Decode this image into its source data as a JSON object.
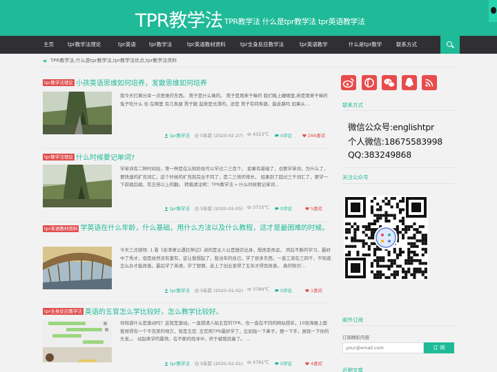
{
  "header": {
    "title": "TPR教学法",
    "subtitle": "TPR教学法 什么是tpr教学法 tpr英语教学法"
  },
  "nav": {
    "items": [
      "主页",
      "tpr教学法理论",
      "tpr英语",
      "tpr教学法",
      "tpr英语教材资料",
      "tpr全身反应教学法",
      "tpr英语教学",
      "什么是tpr教学",
      "联系方式"
    ],
    "search_icon": "search-icon"
  },
  "notice": {
    "icon": "speaker-icon",
    "text": "TPR教学法,什么是tpr教学法,tpr教学法优点,tpr教学法资料"
  },
  "articles": [
    {
      "tag": "tpr教学法理论",
      "title": "小孩英语思维如何培养，发散思维如何培养",
      "excerpt": "我今天打算分享一点思维的东西。  凳子是什么做的。  凳子是用来干嘛的  我们晚上睡哪里,床是用来干嘛的  兔子吃什么 住 在哪里   有几条腿 凳子腿 起来是光滑的。还是  凳子有四条腿，能走路吗  如果从...",
      "author": "tpr教学法",
      "time": "5年前 (2020-02-27)",
      "views": "4323℃",
      "comments": "0评论",
      "likes": "286喜欢"
    },
    {
      "tag": "tpr教学法理论",
      "title": "什么时候要记单词?",
      "excerpt": "学单词有二种时间段，第一种是在认知阶段可以学过二三百个，  如果有基础了，也要学单词，为什么了，要快速的扩充词汇，这个时候的扩充就完全不同了，是二三倍的增长，  如果到了超过三千词汇了，要学一下前缀后缀，有五倍以上的翻。  转载请注明：TPR教学法 » 什么时候要记单词...",
      "author": "tpr教学法",
      "time": "5年前 (2020-02-05)",
      "views": "3715℃",
      "comments": "0评论",
      "likes": "5喜欢"
    },
    {
      "tag": "tpr英语教材资料",
      "title": "学英语在什么年龄，什么基础，用什么方法以及什么教程，这才是最困难的时候。",
      "excerpt": "今天三点感悟: 1.看《俞净意公遇灶神记》讲的是主人公是傲农出身，想改变命运，  然后不断的学习，最好中了秀才，但是依然没有富有，这让我想起了，我当年的自己，学了很多东西，一直工资在三四千，不知道怎么办才能改善。最后学了英语，学了塑钢，走上了创业发得了五年才得到改善。 真的知识...",
      "author": "tpr教学法",
      "time": "5年前 (2020-02-02)",
      "views": "3789℃",
      "comments": "0评论",
      "likes": "1喜欢"
    },
    {
      "tag": "tpr全身反应教学法",
      "title": "英语的五官怎么学比较好，怎么教学比较好。",
      "excerpt": "你知道什么是激动吗？这就是激动。一直想请人拍五官的TPR，也一直在不同的网站想买，10张海报上面我觉得有一个不完美的地方，就是五官. 五官用TPR最好学了，比如指一下鼻子，摆一下手，展现一下你的头发。。  动起来学的最快。在不断的找寻中，终于被我找着了。 ...",
      "author": "tpr教学法",
      "time": "5年前 (2020-02-01)",
      "views": "4781℃",
      "comments": "0评论",
      "likes": "4喜欢"
    }
  ],
  "sidebar": {
    "social_icons": [
      "weibo-icon",
      "tencent-weibo-icon",
      "wechat-icon",
      "qq-icon",
      "rss-icon"
    ],
    "contact_title": "联系方式",
    "contact_lines": [
      "微信公众号:englishtpr",
      "个人微信:18675583998",
      "QQ:383249868"
    ],
    "qr_title": "关注公众号",
    "subscribe_title": "邮件订阅",
    "subscribe_label": "订阅精彩内容",
    "email_placeholder": "your@email.com",
    "subscribe_button": "订 阅",
    "more_title": "近期文章"
  },
  "colors": {
    "accent": "#1fba98",
    "nav": "#303034",
    "tag": "#e04e4e"
  }
}
